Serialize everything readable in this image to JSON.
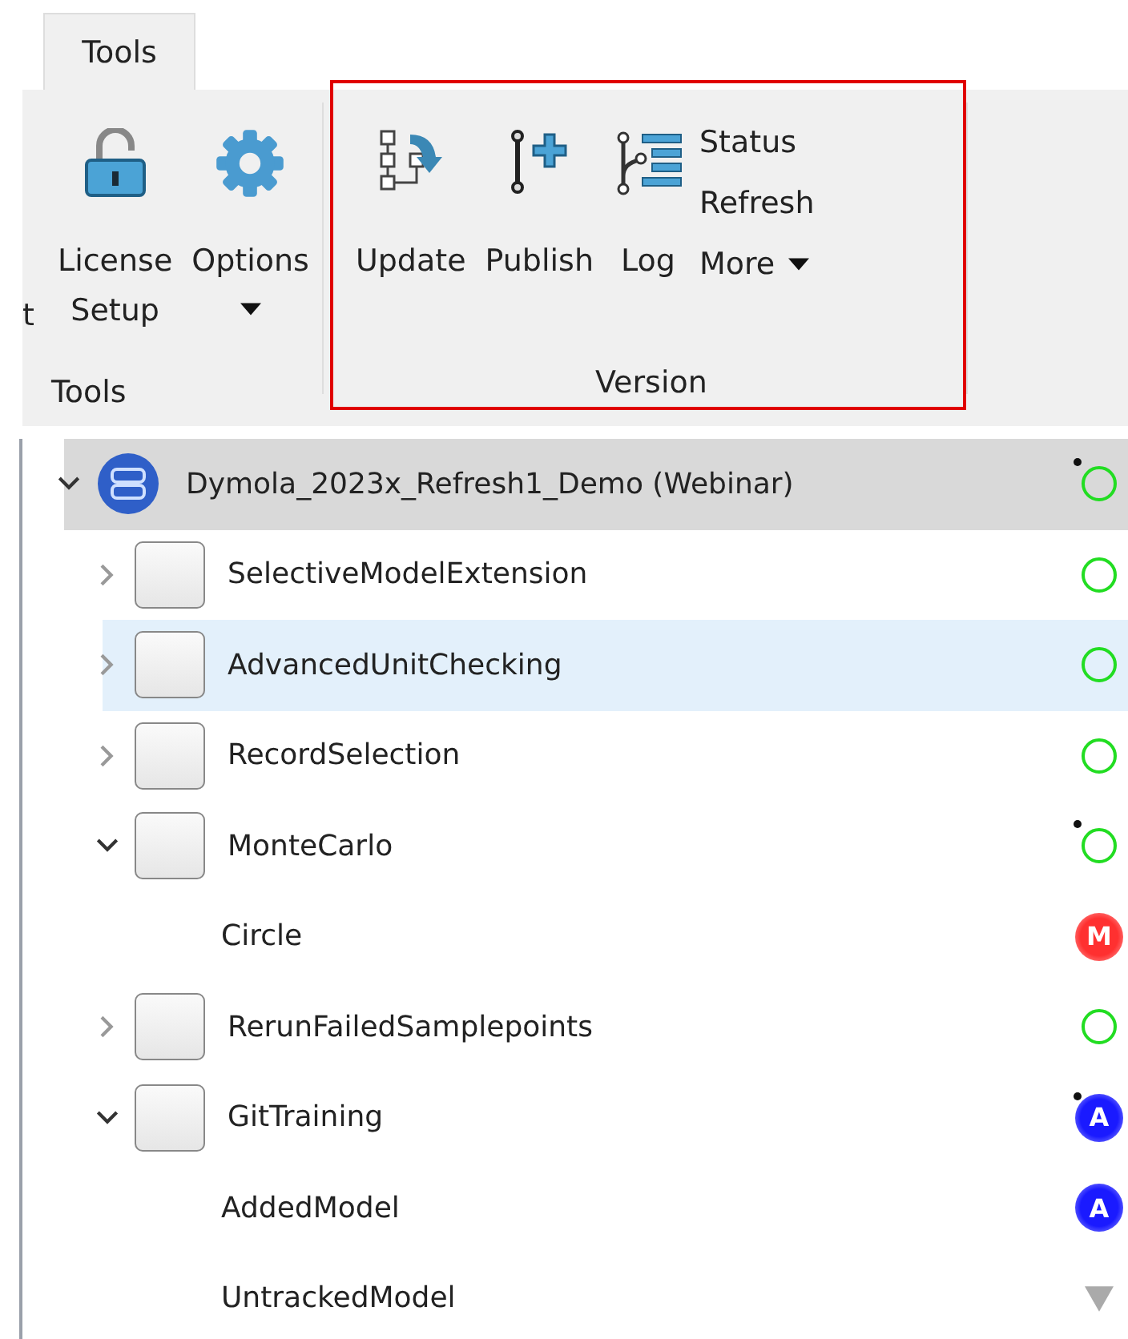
{
  "ribbon": {
    "tabs": [
      {
        "label": "Tools",
        "selected": true
      }
    ],
    "cut_text": "t",
    "groups": [
      {
        "label": "Tools",
        "highlighted": false,
        "items": [
          {
            "kind": "lock",
            "lines": [
              "License",
              "Setup"
            ],
            "dropdown": false
          },
          {
            "kind": "gear",
            "lines": [
              "Options"
            ],
            "dropdown": true
          }
        ]
      },
      {
        "label": "Version",
        "highlighted": true,
        "items": [
          {
            "kind": "update",
            "lines": [
              "Update"
            ],
            "dropdown": false
          },
          {
            "kind": "publish",
            "lines": [
              "Publish"
            ],
            "dropdown": false
          },
          {
            "kind": "log",
            "lines": [
              "Log"
            ],
            "dropdown": false
          },
          {
            "kind": "stack",
            "entries": [
              {
                "label": "Status",
                "dropdown": false
              },
              {
                "label": "Refresh",
                "dropdown": false
              },
              {
                "label": "More",
                "dropdown": true
              }
            ]
          }
        ]
      }
    ]
  },
  "tree": [
    {
      "label": "Dymola_2023x_Refresh1_Demo (Webinar)",
      "kind": "library",
      "expanded": true,
      "selected": true,
      "hovered": false,
      "state": {
        "kind": "clean"
      },
      "has_changes": true,
      "children": [
        {
          "label": "SelectiveModelExtension",
          "kind": "package",
          "expanded": false,
          "selected": false,
          "hovered": false,
          "state": {
            "kind": "clean"
          },
          "has_changes": false
        },
        {
          "label": "AdvancedUnitChecking",
          "kind": "package",
          "expanded": false,
          "selected": false,
          "hovered": true,
          "state": {
            "kind": "clean"
          },
          "has_changes": false
        },
        {
          "label": "RecordSelection",
          "kind": "package",
          "expanded": false,
          "selected": false,
          "hovered": false,
          "state": {
            "kind": "clean"
          },
          "has_changes": false
        },
        {
          "label": "MonteCarlo",
          "kind": "package",
          "expanded": true,
          "selected": false,
          "hovered": false,
          "state": {
            "kind": "clean"
          },
          "has_changes": true,
          "children": [
            {
              "label": "Circle",
              "selected": false,
              "hovered": false,
              "state": {
                "kind": "modified",
                "label": "M"
              },
              "has_changes": false
            }
          ]
        },
        {
          "label": "RerunFailedSamplepoints",
          "kind": "package",
          "expanded": false,
          "selected": false,
          "hovered": false,
          "state": {
            "kind": "clean"
          },
          "has_changes": false
        },
        {
          "label": "GitTraining",
          "kind": "package",
          "expanded": true,
          "selected": false,
          "hovered": false,
          "state": {
            "kind": "added",
            "label": "A"
          },
          "has_changes": true,
          "children": [
            {
              "label": "AddedModel",
              "selected": false,
              "hovered": false,
              "state": {
                "kind": "added",
                "label": "A"
              },
              "has_changes": false
            },
            {
              "label": "UntrackedModel",
              "selected": false,
              "hovered": false,
              "state": {
                "kind": "untracked"
              },
              "has_changes": false
            }
          ]
        }
      ]
    }
  ]
}
